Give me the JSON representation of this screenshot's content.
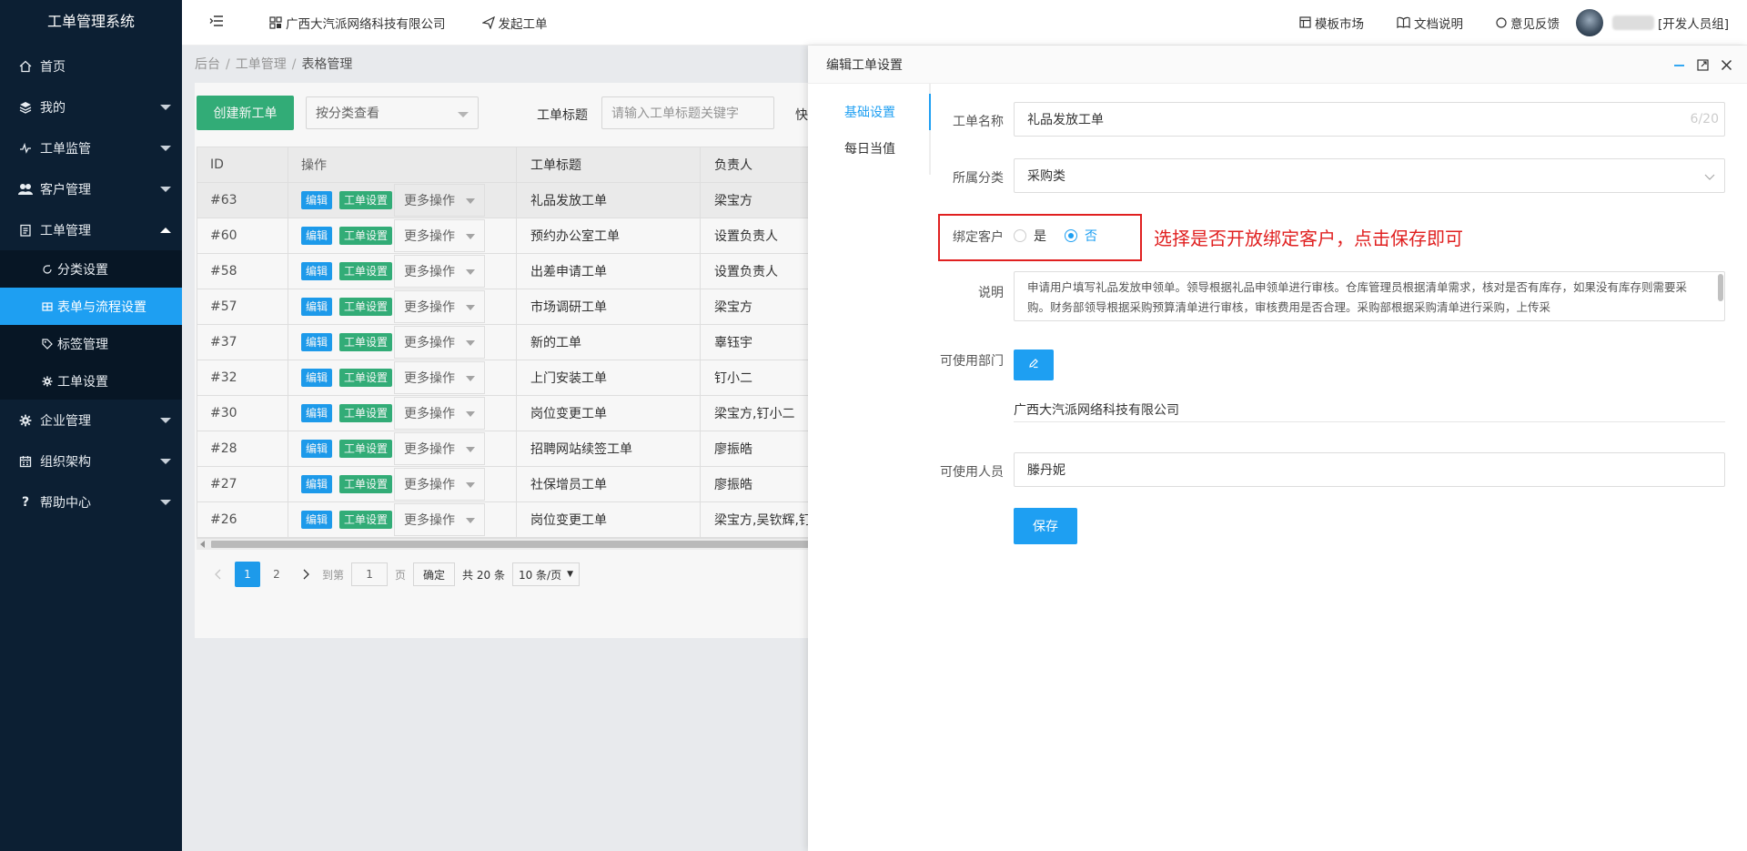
{
  "app": {
    "title": "工单管理系统"
  },
  "sidebar": {
    "items": [
      {
        "label": "首页",
        "icon": "home-icon",
        "has_caret": false
      },
      {
        "label": "我的",
        "icon": "layers-icon",
        "has_caret": true
      },
      {
        "label": "工单监管",
        "icon": "pulse-icon",
        "has_caret": true
      },
      {
        "label": "客户管理",
        "icon": "users-icon",
        "has_caret": true
      },
      {
        "label": "工单管理",
        "icon": "clipboard-icon",
        "has_caret": true,
        "expanded": true
      }
    ],
    "submenu": [
      {
        "label": "分类设置",
        "icon": "refresh-icon"
      },
      {
        "label": "表单与流程设置",
        "icon": "grid-icon",
        "active": true
      },
      {
        "label": "标签管理",
        "icon": "tag-icon"
      },
      {
        "label": "工单设置",
        "icon": "gear-icon"
      }
    ],
    "items_after": [
      {
        "label": "企业管理",
        "icon": "gear-icon",
        "has_caret": true
      },
      {
        "label": "组织架构",
        "icon": "calendar-icon",
        "has_caret": true
      },
      {
        "label": "帮助中心",
        "icon": "question-icon",
        "has_caret": true
      }
    ]
  },
  "header": {
    "company": "广西大汽派网络科技有限公司",
    "new_ticket": "发起工单",
    "template_market": "模板市场",
    "docs": "文档说明",
    "feedback": "意见反馈",
    "user_group": "[开发人员组]"
  },
  "breadcrumb": [
    "后台",
    "工单管理",
    "表格管理"
  ],
  "toolbar": {
    "create_label": "创建新工单",
    "category_select": "按分类查看",
    "title_filter_label": "工单标题",
    "title_filter_placeholder": "请输入工单标题关键字",
    "extra_label": "快"
  },
  "table": {
    "headers": [
      "ID",
      "操作",
      "工单标题",
      "负责人"
    ],
    "edit_label": "编辑",
    "settings_label": "工单设置",
    "more_label": "更多操作",
    "rows": [
      {
        "id": "#63",
        "title": "礼品发放工单",
        "owner": "梁宝方"
      },
      {
        "id": "#60",
        "title": "预约办公室工单",
        "owner": "设置负责人"
      },
      {
        "id": "#58",
        "title": "出差申请工单",
        "owner": "设置负责人"
      },
      {
        "id": "#57",
        "title": "市场调研工单",
        "owner": "梁宝方"
      },
      {
        "id": "#37",
        "title": "新的工单",
        "owner": "辜钰宇"
      },
      {
        "id": "#32",
        "title": "上门安装工单",
        "owner": "钉小二"
      },
      {
        "id": "#30",
        "title": "岗位变更工单",
        "owner": "梁宝方,钉小二"
      },
      {
        "id": "#28",
        "title": "招聘网站续签工单",
        "owner": "廖振皓"
      },
      {
        "id": "#27",
        "title": "社保增员工单",
        "owner": "廖振皓"
      },
      {
        "id": "#26",
        "title": "岗位变更工单",
        "owner": "梁宝方,吴钦辉,钉"
      }
    ]
  },
  "pagination": {
    "pages": [
      "1",
      "2"
    ],
    "goto_label": "到第",
    "goto_value": "1",
    "page_unit": "页",
    "confirm": "确定",
    "total": "共 20 条",
    "page_size": "10 条/页"
  },
  "drawer": {
    "title": "编辑工单设置",
    "tabs": [
      "基础设置",
      "每日当值"
    ],
    "form": {
      "name_label": "工单名称",
      "name_value": "礼品发放工单",
      "name_counter": "6/20",
      "category_label": "所属分类",
      "category_value": "采购类",
      "bind_label": "绑定客户",
      "bind_yes": "是",
      "bind_no": "否",
      "desc_label": "说明",
      "desc_value": "申请用户填写礼品发放申领单。领导根据礼品申领单进行审核。仓库管理员根据清单需求，核对是否有库存，如果没有库存则需要采购。财务部领导根据采购预算清单进行审核，审核费用是否合理。采购部根据采购清单进行采购，上传采",
      "dept_label": "可使用部门",
      "dept_value": "广西大汽派网络科技有限公司",
      "people_label": "可使用人员",
      "people_value": "滕丹妮",
      "save": "保存"
    },
    "annotation": "选择是否开放绑定客户，点击保存即可"
  },
  "colors": {
    "sidebar_bg": "#0c1f33",
    "accent": "#1e9ff2",
    "green": "#34b27b",
    "annotation_red": "#e02020"
  }
}
